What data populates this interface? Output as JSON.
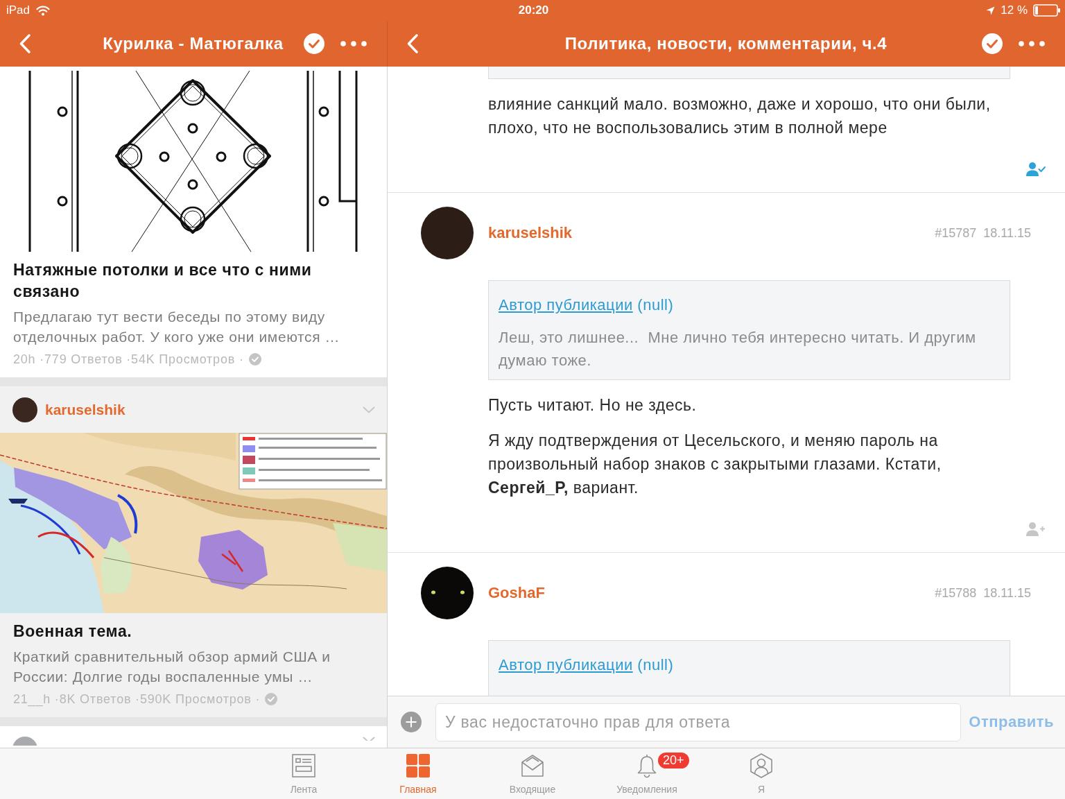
{
  "status_bar": {
    "device": "iPad",
    "time": "20:20",
    "battery": "12 %"
  },
  "left_pane": {
    "nav": {
      "title": "Курилка - Матюгалка"
    },
    "posts": [
      {
        "kind": "topic",
        "selected": false,
        "picture": {
          "kind": "plan"
        },
        "title": "Натяжные потолки и все что с ними связано",
        "excerpt": "Предлагаю тут вести беседы по этому виду отделочных работ. У кого уже они имеются …",
        "meta": "20h ·779 Ответов ·54K Просмотров ·",
        "verified": true
      },
      {
        "kind": "topic",
        "selected": true,
        "author": "karuselshik",
        "picture": {
          "kind": "map"
        },
        "title": "Военная тема.",
        "excerpt": "Краткий сравнительный обзор армий США и России: Долгие годы воспаленные умы …",
        "meta": "21__h ·8K Ответов ·590K Просмотров ·",
        "verified": true
      },
      {
        "kind": "peek",
        "selected": false
      }
    ]
  },
  "right_pane": {
    "nav": {
      "title": "Политика, новости, комментарии, ч.4"
    },
    "comments": [
      {
        "kind": "partial",
        "paragraphs": [
          "влияние санкций мало. возможно, даже и хорошо, что они были, плохо, что не воспользовались этим в полной мере"
        ],
        "following": true
      },
      {
        "kind": "full",
        "avatar": {
          "kind": "photo"
        },
        "author": "karuselshik",
        "number": "#15787",
        "date": "18.11.15",
        "quote": {
          "source": "Автор публикации",
          "note": "(null)",
          "text": "Леш, это лишнее...  Мне лично тебя интересно читать. И другим думаю тоже."
        },
        "paragraphs": [
          "Пусть читают. Но не здесь.",
          "Я жду подтверждения от Цесельского, и меняю пароль на произвольный набор знаков с закрытыми глазами. Кстати, **Сергей_Р,** вариант."
        ],
        "following": false
      },
      {
        "kind": "full",
        "avatar": {
          "kind": "eyes"
        },
        "author": "GoshaF",
        "number": "#15788",
        "date": "18.11.15",
        "quote": {
          "source": "Автор публикации",
          "note": "(null)"
        }
      }
    ],
    "reply_bar": {
      "placeholder": "У вас недостаточно прав для ответа",
      "send": {
        "label": "Отправить",
        "disabled": true
      }
    }
  },
  "tab_bar": {
    "tabs": [
      {
        "kind": "feed",
        "label": "Лента",
        "selected": false
      },
      {
        "kind": "home",
        "label": "Главная",
        "selected": true
      },
      {
        "kind": "inbox",
        "label": "Входящие",
        "selected": false
      },
      {
        "kind": "alerts",
        "label": "Уведомления",
        "selected": false,
        "badge": "20+"
      },
      {
        "kind": "profile",
        "label": "Я",
        "selected": false
      }
    ]
  }
}
